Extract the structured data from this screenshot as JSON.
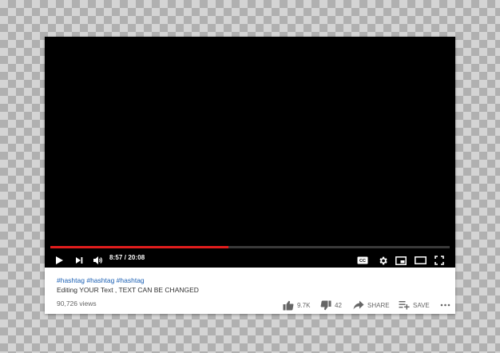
{
  "player": {
    "current_time": "8:57",
    "duration": "20:08",
    "time_display": "8:57 / 20:08",
    "progress_fraction": 0.446,
    "colors": {
      "progress": "#e11d1d",
      "track": "#3a3a3a",
      "background": "#000000"
    }
  },
  "controls": {
    "left": [
      "play-icon",
      "next-icon",
      "volume-icon"
    ],
    "right": [
      "captions-icon",
      "settings-gear-icon",
      "miniplayer-icon",
      "theater-mode-icon",
      "fullscreen-icon"
    ],
    "captions_label": "CC"
  },
  "video": {
    "hashtags": "#hashtag #hashtag #hashtag",
    "title": "Editing YOUR Text , TEXT CAN BE CHANGED",
    "views": "90,726 views"
  },
  "actions": {
    "likes": "9.7K",
    "dislikes": "42",
    "share_label": "SHARE",
    "save_label": "SAVE",
    "icons": [
      "thumbs-up-icon",
      "thumbs-down-icon",
      "share-arrow-icon",
      "playlist-add-icon",
      "more-horizontal-icon"
    ]
  }
}
